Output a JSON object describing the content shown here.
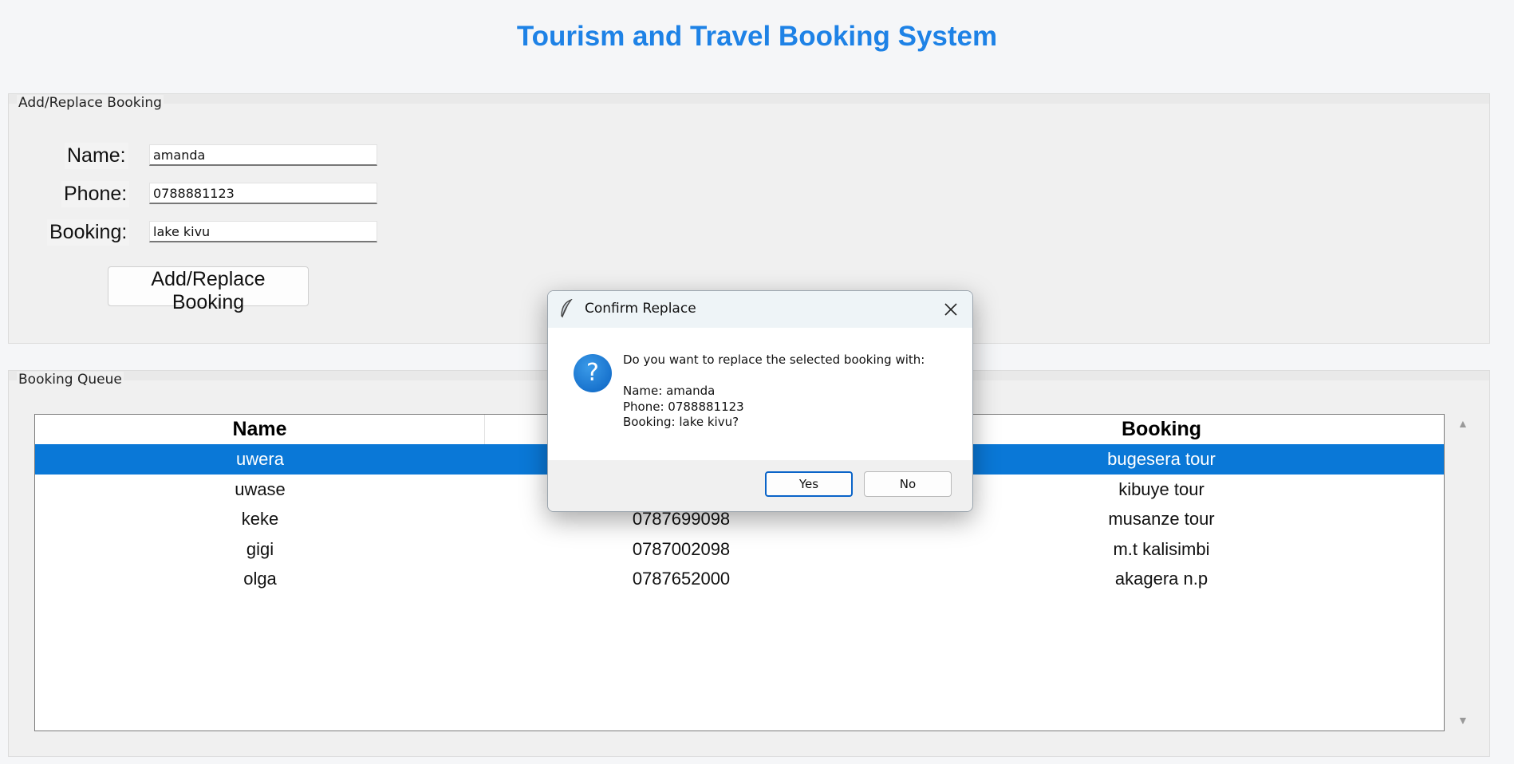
{
  "app": {
    "title": "Tourism and Travel Booking System"
  },
  "form": {
    "section_label": "Add/Replace Booking",
    "name_label": "Name:",
    "name_value": "amanda",
    "phone_label": "Phone:",
    "phone_value": "0788881123",
    "booking_label": "Booking:",
    "booking_value": "lake kivu",
    "submit_label": "Add/Replace Booking"
  },
  "queue": {
    "section_label": "Booking Queue",
    "columns": [
      "Name",
      "",
      "Booking"
    ],
    "rows": [
      {
        "name": "uwera",
        "phone": "",
        "booking": "bugesera tour",
        "selected": true
      },
      {
        "name": "uwase",
        "phone": "",
        "booking": "kibuye tour",
        "selected": false
      },
      {
        "name": "keke",
        "phone": "0787699098",
        "booking": "musanze tour",
        "selected": false
      },
      {
        "name": "gigi",
        "phone": "0787002098",
        "booking": "m.t kalisimbi",
        "selected": false
      },
      {
        "name": "olga",
        "phone": "0787652000",
        "booking": "akagera n.p",
        "selected": false
      }
    ],
    "scroll_up_glyph": "▲",
    "scroll_down_glyph": "▼"
  },
  "dialog": {
    "title": "Confirm Replace",
    "icon": "question-icon",
    "icon_glyph": "?",
    "message": "Do you want to replace the selected booking with:\n\nName: amanda\nPhone: 0788881123\nBooking: lake kivu?",
    "yes_label": "Yes",
    "no_label": "No"
  },
  "colors": {
    "title": "#1e82e6",
    "selection": "#0a78d7",
    "dialog_titlebar": "#eef4f7",
    "question_icon": "#0a62c2"
  }
}
